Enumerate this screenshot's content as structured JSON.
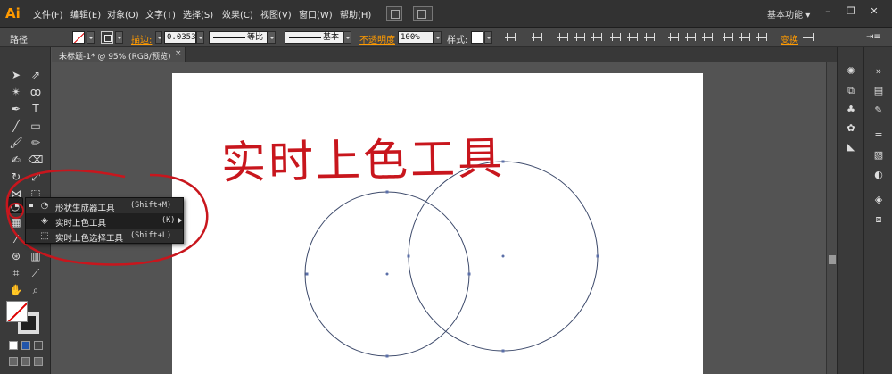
{
  "app": {
    "logo": "Ai"
  },
  "menu": {
    "items": [
      "文件(F)",
      "编辑(E)",
      "对象(O)",
      "文字(T)",
      "选择(S)",
      "效果(C)",
      "视图(V)",
      "窗口(W)",
      "帮助(H)"
    ]
  },
  "workspace": {
    "label": "基本功能",
    "arrow": "▾"
  },
  "window_controls": {
    "minimize": "–",
    "restore": "❐",
    "close": "✕"
  },
  "control_bar": {
    "object_type": "路径",
    "stroke_label": "描边:",
    "stroke_value": "0.0353",
    "profile_label": "等比",
    "brush_label": "基本",
    "opacity_label": "不透明度",
    "opacity_value": "100%",
    "style_label": "样式:",
    "transform_label": "变换",
    "end_icon": "⇥≡"
  },
  "document_tab": {
    "title": "未标题-1* @ 95% (RGB/预览)",
    "close": "×"
  },
  "flyout": {
    "items": [
      {
        "label": "形状生成器工具",
        "shortcut": "(Shift+M)",
        "icon": "shape-builder-icon",
        "glyph": "◔",
        "selected": false,
        "bullet": true
      },
      {
        "label": "实时上色工具",
        "shortcut": "(K)",
        "icon": "live-paint-bucket-icon",
        "glyph": "◈",
        "selected": true,
        "bullet": false
      },
      {
        "label": "实时上色选择工具",
        "shortcut": "(Shift+L)",
        "icon": "live-paint-selection-icon",
        "glyph": "⬚",
        "selected": false,
        "bullet": false
      }
    ]
  },
  "annotation": {
    "text": "实时上色工具",
    "color": "#c8161d"
  },
  "colors": {
    "accent": "#ff9a00",
    "annotation_red": "#c8161d",
    "path_stroke": "#3d4a6b",
    "anchor": "#5b6fa8"
  }
}
